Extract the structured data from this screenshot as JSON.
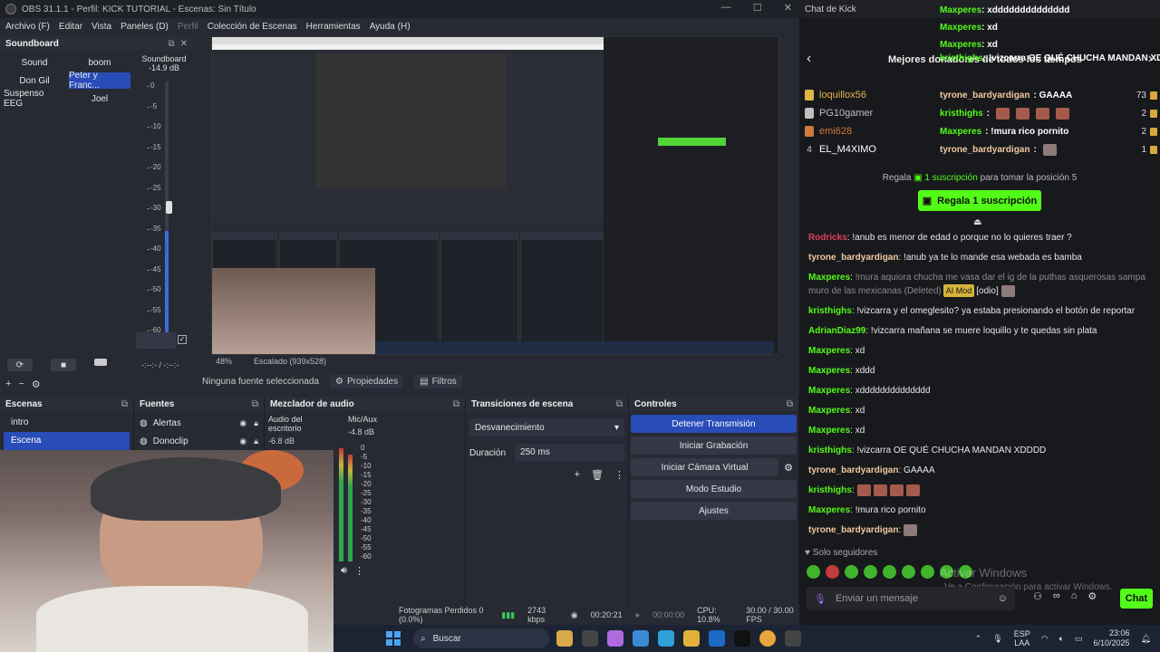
{
  "obs": {
    "title": "OBS 31.1.1 - Perfil: KICK TUTORIAL - Escenas: Sin Título",
    "menu": [
      "Archivo (F)",
      "Editar",
      "Vista",
      "Paneles (D)",
      "Perfil",
      "Colección de Escenas",
      "Herramientas",
      "Ayuda (H)"
    ],
    "soundboard": {
      "title": "Soundboard",
      "buttons": [
        {
          "label": "Sound",
          "active": false
        },
        {
          "label": "boom",
          "active": false
        },
        {
          "label": "Don Gil",
          "active": false
        },
        {
          "label": "Peter y Franc...",
          "active": true
        },
        {
          "label": "Suspenso EEG",
          "active": false
        },
        {
          "label": "Joel",
          "active": false
        }
      ],
      "meter_label": "Soundboard",
      "meter_db": "-14.9 dB",
      "meter_ticks": [
        "0",
        "-5",
        "-10",
        "-15",
        "-20",
        "-25",
        "-30",
        "-35",
        "-40",
        "-45",
        "-50",
        "-55",
        "-60"
      ],
      "time": "-:--:- / -:--:-"
    },
    "preview": {
      "zoom": "48%",
      "scale": "Escalado (939x528)"
    },
    "source_toolbar": {
      "no_source": "Ninguna fuente seleccionada",
      "properties": "Propiedades",
      "filters": "Filtros"
    },
    "scenes": {
      "title": "Escenas",
      "items": [
        {
          "label": "intro",
          "active": false
        },
        {
          "label": "Escena",
          "active": true
        }
      ]
    },
    "sources": {
      "title": "Fuentes",
      "items": [
        "Alertas",
        "Donoclip"
      ]
    },
    "mixer": {
      "title": "Mezclador de audio",
      "channels": [
        {
          "name": "Audio del escritorio",
          "db": "-6.8 dB"
        },
        {
          "name": "Mic/Aux",
          "db": "-4.8 dB"
        }
      ],
      "scale": [
        "0",
        "-5",
        "-10",
        "-15",
        "-20",
        "-25",
        "-30",
        "-35",
        "-40",
        "-45",
        "-50",
        "-55",
        "-60"
      ]
    },
    "transitions": {
      "title": "Transiciones de escena",
      "selected": "Desvanecimiento",
      "duration_label": "Duración",
      "duration_value": "250 ms"
    },
    "controls": {
      "title": "Controles",
      "buttons": [
        "Detener Transmisión",
        "Iniciar Grabación",
        "Iniciar Cámara Virtual",
        "Modo Estudio",
        "Ajustes"
      ]
    },
    "status": {
      "dropped": "Fotogramas Perdidos 0 (0.0%)",
      "bitrate": "2743 kbps",
      "live_time": "00:20:21",
      "rec_time": "00:00:00",
      "cpu": "CPU: 10.8%",
      "fps": "30.00 / 30.00 FPS"
    }
  },
  "chat": {
    "window_title": "Chat de Kick",
    "header": "Mejores donadores de todos los tiempos",
    "overlay_lines": [
      {
        "user": "Maxperes",
        "text": ": xdddddddddddddd"
      },
      {
        "user": "Maxperes",
        "text": ": xd"
      },
      {
        "user": "Maxperes",
        "text": ": xd"
      },
      {
        "user": "kristhighs",
        "text": ": !vizcarra OE QUÉ CHUCHA MANDAN XDDDD"
      }
    ],
    "leaderboard": [
      {
        "rank": "1",
        "name": "loquillox56",
        "color": "#e0b64a"
      },
      {
        "rank": "2",
        "name": "PG10gamer",
        "color": "#bfbfbf"
      },
      {
        "rank": "3",
        "name": "emi628",
        "color": "#d07a3c"
      },
      {
        "rank": "4",
        "name": "EL_M4XIMO",
        "color": "#ffffff"
      }
    ],
    "leaderboard_overlay": [
      {
        "user": "tyrone_bardyardigan",
        "text": ": GAAAA",
        "count": "73"
      },
      {
        "user": "kristhighs",
        "text": ":",
        "count": "2"
      },
      {
        "user": "Maxperes",
        "text": ": !mura rico pornito",
        "count": "2"
      },
      {
        "user": "tyrone_bardyardigan",
        "text": ":",
        "count": "1"
      }
    ],
    "regala_text_pre": "Regala",
    "regala_text_sub": "1 suscripción",
    "regala_text_post": "para tomar la posición 5",
    "regala_button": "Regala 1 suscripción",
    "messages": [
      {
        "user": "Rodricks",
        "color": "#e0405a",
        "text": ": !anub es menor de edad o porque no lo quieres traer ?"
      },
      {
        "user": "tyrone_bardyardigan",
        "color": "#f1c99e",
        "text": ": !anub ya te lo mande esa webada es bamba"
      },
      {
        "user": "Maxperes",
        "color": "#53fc18",
        "text": ":",
        "deleted": "!mura aquiora chucha me vasa dar el ig de la puthas asquerosas sampa muro de las mexicanas",
        "deleted_tag": "(Deleted)",
        "badge": "AI Mod",
        "extra": "[odio]"
      },
      {
        "user": "kristhighs",
        "color": "#53fc18",
        "text": ": !vizcarra y el omeglesito? ya estaba presionando el botón de reportar"
      },
      {
        "user": "AdrianDiaz99",
        "color": "#53fc18",
        "text": ": !vizcarra mañana se muere loquillo y te quedas sin plata"
      },
      {
        "user": "Maxperes",
        "color": "#53fc18",
        "text": ": xd"
      },
      {
        "user": "Maxperes",
        "color": "#53fc18",
        "text": ": xddd"
      },
      {
        "user": "Maxperes",
        "color": "#53fc18",
        "text": ": xdddddddddddddd"
      },
      {
        "user": "Maxperes",
        "color": "#53fc18",
        "text": ": xd"
      },
      {
        "user": "Maxperes",
        "color": "#53fc18",
        "text": ": xd"
      },
      {
        "user": "kristhighs",
        "color": "#53fc18",
        "text": ": !vizcarra OE QUÉ CHUCHA MANDAN XDDDD"
      },
      {
        "user": "tyrone_bardyardigan",
        "color": "#f1c99e",
        "text": ": GAAAA"
      },
      {
        "user": "kristhighs",
        "color": "#53fc18",
        "text": ":"
      },
      {
        "user": "Maxperes",
        "color": "#53fc18",
        "text": ": !mura rico pornito"
      },
      {
        "user": "tyrone_bardyardigan",
        "color": "#f1c99e",
        "text": ":"
      }
    ],
    "followers_only": "Solo seguidores",
    "watermark_1": "Activar Windows",
    "watermark_2": "Ve a Configuración para activar Windows.",
    "input_placeholder": "Enviar un mensaje",
    "send_button": "Chat"
  },
  "taskbar": {
    "search": "Buscar",
    "lang_top": "ESP",
    "lang_bottom": "LAA",
    "time": "23:06",
    "date": "6/10/2025"
  }
}
